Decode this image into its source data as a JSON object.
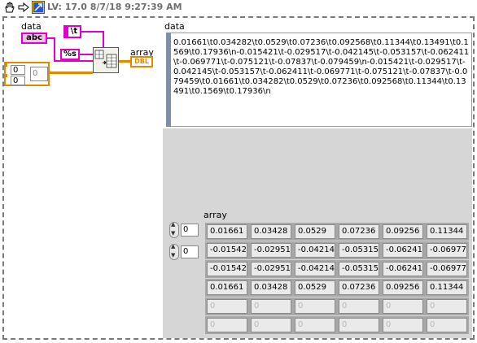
{
  "toolbar": {
    "version_label": "LV: 17.0 8/7/18 9:27:39 AM",
    "icons": [
      "hand-pan-icon",
      "arrow-right-icon",
      "labview-snippet-icon"
    ]
  },
  "block_diagram": {
    "data_label": "data",
    "data_terminal": "abc",
    "tab_constant": "\\t",
    "format_constant": "%s",
    "array_label": "array",
    "array_terminal": "DBL",
    "array_const_index_1": "0",
    "array_const_index_2": "0",
    "array_const_element": "0"
  },
  "front_panel": {
    "data_label": "data",
    "data_value": "0.01661\\t0.034282\\t0.0529\\t0.07236\\t0.092568\\t0.11344\\t0.13491\\t0.1569\\t0.17936\\n-0.015421\\t-0.029517\\t-0.042145\\t-0.053157\\t-0.062411\\t-0.069771\\t-0.075121\\t-0.07837\\t-0.079459\\n-0.015421\\t-0.029517\\t-0.042145\\t-0.053157\\t-0.062411\\t-0.069771\\t-0.075121\\t-0.07837\\t-0.079459\\t0.01661\\t0.034282\\t0.0529\\t0.07236\\t0.092568\\t0.11344\\t0.13491\\t0.1569\\t0.17936\\n",
    "array_label": "array",
    "row_index": "0",
    "col_index": "0",
    "rows": [
      [
        "0.01661",
        "0.03428",
        "0.0529",
        "0.07236",
        "0.09256",
        "0.11344"
      ],
      [
        "-0.01542",
        "-0.02951",
        "-0.04214",
        "-0.05315",
        "-0.06241",
        "-0.06977"
      ],
      [
        "-0.01542",
        "-0.02951",
        "-0.04214",
        "-0.05315",
        "-0.06241",
        "-0.06977"
      ],
      [
        "0.01661",
        "0.03428",
        "0.0529",
        "0.07236",
        "0.09256",
        "0.11344"
      ],
      [
        "0",
        "0",
        "0",
        "0",
        "0",
        "0"
      ],
      [
        "0",
        "0",
        "0",
        "0",
        "0",
        "0"
      ]
    ]
  },
  "colors": {
    "string_wire": "#e000c8",
    "numeric_wire": "#e08a00",
    "panel_gray": "#d6d6d6"
  }
}
